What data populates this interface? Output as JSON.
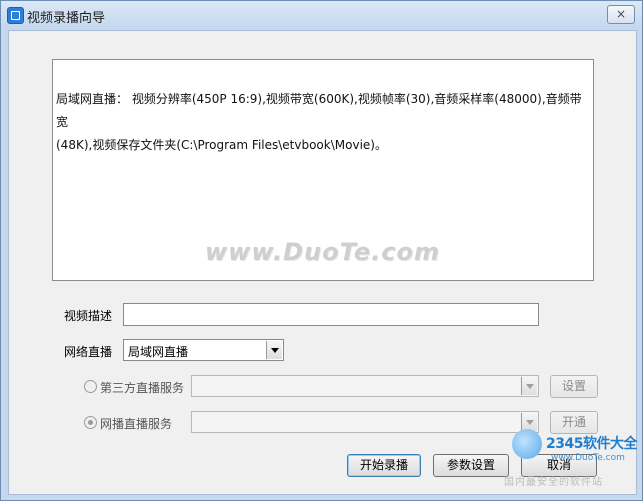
{
  "window": {
    "title": "视频录播向导",
    "close_symbol": "×"
  },
  "info": {
    "line1": "局域网直播： 视频分辨率(450P 16:9),视频带宽(600K),视频帧率(30),音频采样率(48000),音频带宽",
    "line2": "(48K),视频保存文件夹(C:\\Program Files\\etvbook\\Movie)。",
    "watermark": "www.DuoTe.com"
  },
  "form": {
    "video_desc_label": "视频描述",
    "video_desc_value": "",
    "network_live_label": "网络直播",
    "network_live_value": "局域网直播",
    "third_party_label": "第三方直播服务",
    "third_party_value": "",
    "third_party_btn": "设置",
    "webcast_label": "网播直播服务",
    "webcast_value": "",
    "webcast_btn": "开通"
  },
  "actions": {
    "start": "开始录播",
    "params": "参数设置",
    "cancel": "取消"
  },
  "branding": {
    "name": "2345软件大全",
    "site": "www.DuoTe.com",
    "tag": "国内最安全的软件站"
  },
  "icons": {
    "app": "app-icon",
    "close": "close-icon",
    "dropdown": "chevron-down-icon"
  }
}
